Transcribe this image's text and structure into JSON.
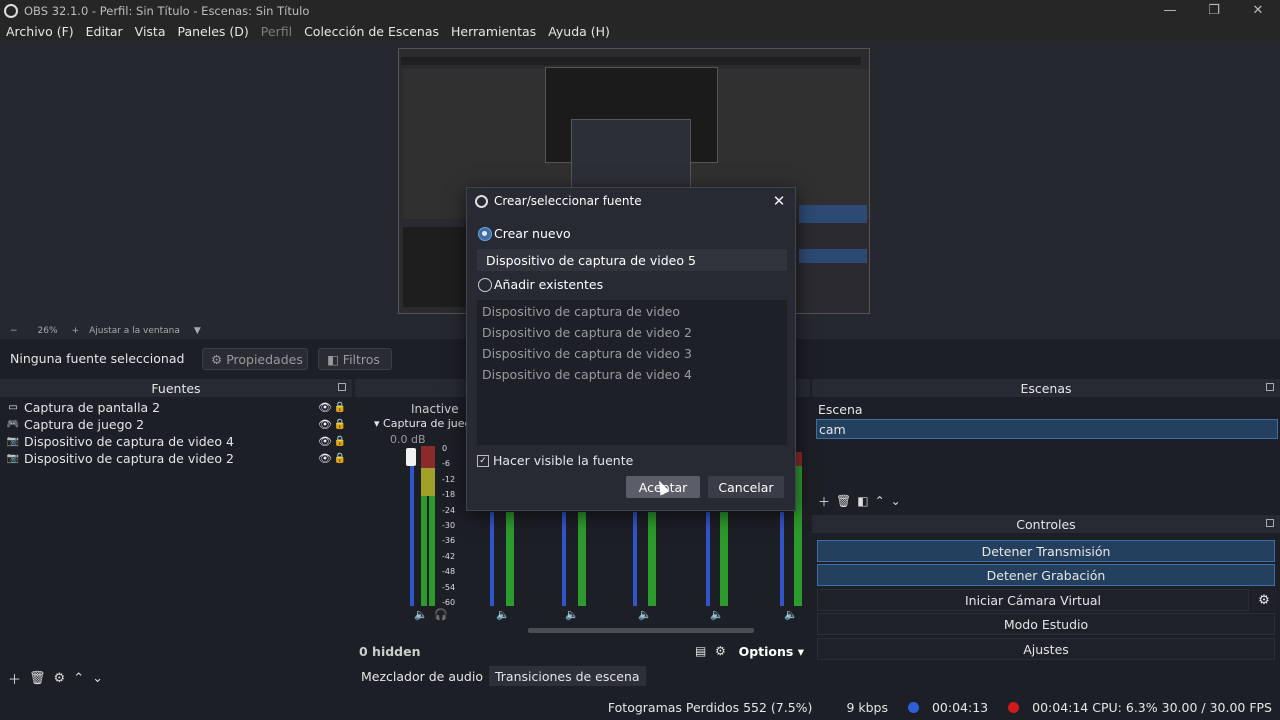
{
  "window": {
    "title": "OBS 32.1.0 - Perfil: Sin Título - Escenas: Sin Título",
    "minimize": "—",
    "maximize": "❐",
    "close": "✕"
  },
  "menu": [
    {
      "label": "Archivo (F)",
      "enabled": true
    },
    {
      "label": "Editar",
      "enabled": true
    },
    {
      "label": "Vista",
      "enabled": true
    },
    {
      "label": "Paneles (D)",
      "enabled": true
    },
    {
      "label": "Perfil",
      "enabled": false
    },
    {
      "label": "Colección de Escenas",
      "enabled": true
    },
    {
      "label": "Herramientas",
      "enabled": true
    },
    {
      "label": "Ayuda (H)",
      "enabled": true
    }
  ],
  "zoom": {
    "minus": "−",
    "value": "26%",
    "plus": "+",
    "fit": "Ajustar a la ventana"
  },
  "source_toolbar": {
    "no_selection": "Ninguna fuente seleccionad",
    "properties": "Propiedades",
    "filters": "Filtros"
  },
  "fuentes": {
    "title": "Fuentes",
    "items": [
      {
        "label": "Captura de pantalla 2",
        "icon": "monitor-icon"
      },
      {
        "label": "Captura de juego 2",
        "icon": "gamepad-icon"
      },
      {
        "label": "Dispositivo de captura de video 4",
        "icon": "camera-icon"
      },
      {
        "label": "Dispositivo de captura de video 2",
        "icon": "camera-icon"
      }
    ]
  },
  "mixer": {
    "inactive_label": "Inactive",
    "track_name": "Captura de juego",
    "db": "0.0 dB",
    "scale": [
      "0",
      "-6",
      "-12",
      "-18",
      "-24",
      "-30",
      "-36",
      "-42",
      "-48",
      "-54",
      "-60"
    ],
    "hidden": "0 hidden",
    "options": "Options",
    "tabs": [
      "Mezclador de audio",
      "Transiciones de escena"
    ]
  },
  "escenas": {
    "title": "Escenas",
    "items": [
      "Escena",
      "cam"
    ],
    "selected": 1
  },
  "controles": {
    "title": "Controles",
    "buttons": [
      {
        "label": "Detener Transmisión",
        "active": true
      },
      {
        "label": "Detener Grabación",
        "active": true
      },
      {
        "label": "Iniciar Cámara Virtual",
        "active": false
      },
      {
        "label": "Modo Estudio",
        "active": false
      },
      {
        "label": "Ajustes",
        "active": false
      }
    ]
  },
  "status": {
    "dropped": "Fotogramas Perdidos 552 (7.5%)",
    "kbps": "9 kbps",
    "stream_time": "00:04:13",
    "rec_time": "00:04:14",
    "cpu": "CPU: 6.3%",
    "fps": "30.00 / 30.00 FPS",
    "colors": {
      "stream": "#2f5fd6",
      "rec": "#d11a1a"
    }
  },
  "dialog": {
    "title": "Crear/seleccionar fuente",
    "create_new": "Crear nuevo",
    "new_name_value": "Dispositivo de captura de video 5",
    "add_existing": "Añadir existentes",
    "existing": [
      "Dispositivo de captura de video",
      "Dispositivo de captura de video 2",
      "Dispositivo de captura de video 3",
      "Dispositivo de captura de video 4"
    ],
    "make_visible": "Hacer visible la fuente",
    "ok": "Aceptar",
    "cancel": "Cancelar"
  }
}
